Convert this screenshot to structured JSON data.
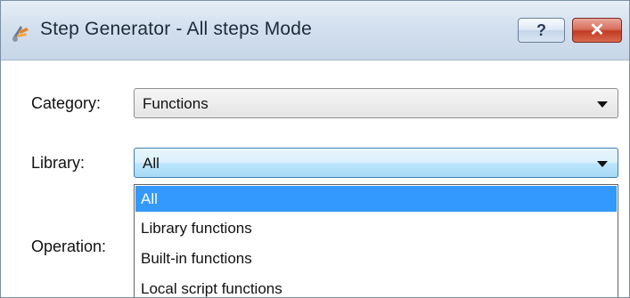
{
  "window": {
    "title": "Step Generator - All steps Mode",
    "help_label": "?",
    "close_label": "✕"
  },
  "form": {
    "category_label": "Category:",
    "category_value": "Functions",
    "library_label": "Library:",
    "library_value": "All",
    "operation_label": "Operation:"
  },
  "library_dropdown": {
    "options": [
      {
        "label": "All",
        "selected": true
      },
      {
        "label": "Library functions",
        "selected": false
      },
      {
        "label": "Built-in functions",
        "selected": false
      },
      {
        "label": "Local script functions",
        "selected": false
      }
    ]
  },
  "icons": {
    "app": "step-generator-icon",
    "help": "question-mark-icon",
    "close": "close-icon",
    "dropdown": "chevron-down-icon"
  },
  "colors": {
    "selection": "#3399ff",
    "close_button": "#c23b22",
    "focus_border": "#3c7fb1"
  }
}
